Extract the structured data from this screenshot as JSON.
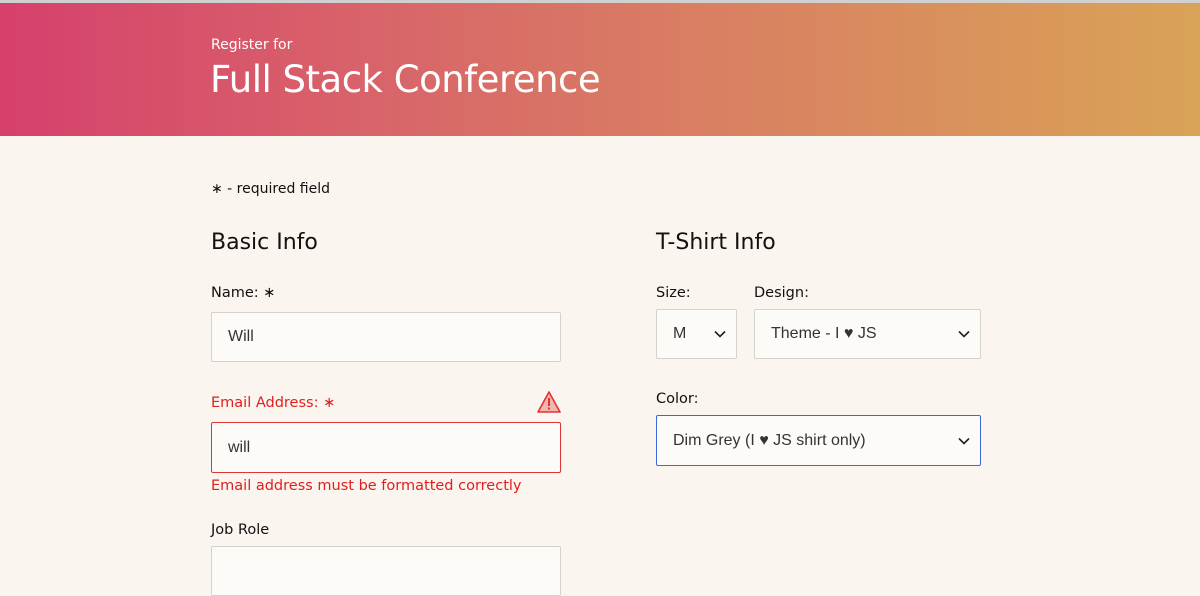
{
  "header": {
    "subtitle": "Register for",
    "title": "Full Stack Conference"
  },
  "form": {
    "required_note": "∗ - required field",
    "basic_info": {
      "title": "Basic Info",
      "name_label": "Name: ∗",
      "name_value": "Will",
      "email_label": "Email Address: ∗",
      "email_value": "will",
      "email_error": "Email address must be formatted correctly",
      "job_role_label": "Job Role"
    },
    "tshirt_info": {
      "title": "T-Shirt Info",
      "size_label": "Size:",
      "size_value": "M",
      "design_label": "Design:",
      "design_value": "Theme - I ♥ JS",
      "color_label": "Color:",
      "color_value": "Dim Grey (I ♥ JS shirt only)"
    }
  },
  "colors": {
    "error": "#e02020",
    "focus": "#3b66dc",
    "gradient_start": "#d6406c",
    "gradient_end": "#d9a357"
  },
  "icons": {
    "warning": "warning-triangle-icon",
    "chevron": "chevron-down-icon"
  }
}
